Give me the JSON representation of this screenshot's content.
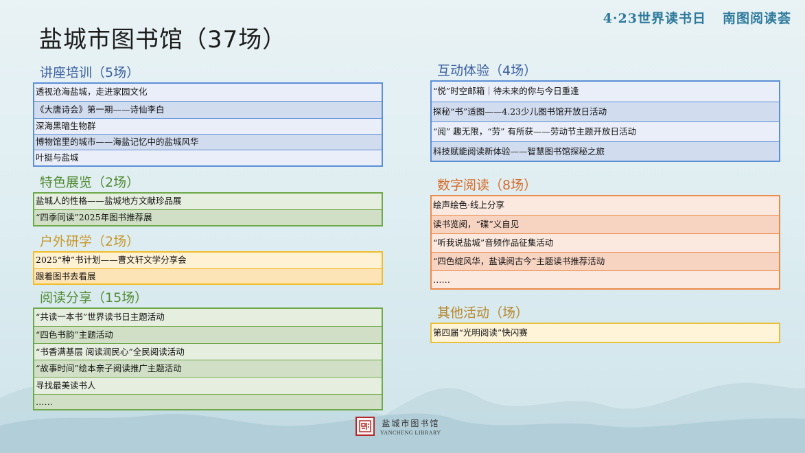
{
  "header": {
    "event_left": "4·23世界读书日",
    "event_right": "南图阅读荟"
  },
  "title": "盐城市图书馆（37场）",
  "sections": {
    "lectures": {
      "heading": "讲座培训（5场）",
      "items": [
        "透视沧海盐城，走进家园文化",
        "《大唐诗会》第一期——诗仙李白",
        "深海黑暗生物群",
        "博物馆里的城市——海盐记忆中的盐城风华",
        "叶挺与盐城"
      ]
    },
    "exhibitions": {
      "heading": "特色展览（2场）",
      "items": [
        "盐城人的性格——盐城地方文献珍品展",
        "“四季同读”2025年图书推荐展"
      ]
    },
    "outdoor": {
      "heading": "户外研学（2场）",
      "items": [
        "2025“种”书计划——曹文轩文学分享会",
        "跟着图书去看展"
      ]
    },
    "reading_share": {
      "heading": "阅读分享（15场）",
      "items": [
        "“共读一本书”世界读书日主题活动",
        "“四色书韵”主题活动",
        "“书香满基层 阅读润民心”全民阅读活动",
        "“故事时间”绘本亲子阅读推广主题活动",
        "寻找最美读书人",
        "……"
      ]
    },
    "interactive": {
      "heading": "互动体验（4场）",
      "items": [
        "“悦”时空邮箱｜待未来的你与今日重逢",
        "探秘“书”适图——4.23少儿图书馆开放日活动",
        "“阅” 趣无限，“劳” 有所获——劳动节主题开放日活动",
        "科技赋能阅读新体验——智慧图书馆探秘之旅"
      ]
    },
    "digital": {
      "heading": "数字阅读（8场）",
      "items": [
        "绘声绘色·线上分享",
        "读书览阅，“碟”义自见",
        "“听我说盐城”音频作品征集活动",
        "“四色绽风华，盐读阅古今”主题读书推荐活动",
        "……"
      ]
    },
    "other": {
      "heading": "其他活动（场）",
      "items": [
        "第四届“光明阅读”快闪赛"
      ]
    }
  },
  "footer": {
    "logo_cn": "盐城市图书馆",
    "logo_en": "YANCHENG LIBRARY"
  },
  "colors": {
    "blue": "#5b8fd6",
    "green": "#6ea848",
    "yellow": "#f0bd2a",
    "orange": "#ec8a4a",
    "gold": "#e8bf3a",
    "header": "#2e7a9c"
  }
}
